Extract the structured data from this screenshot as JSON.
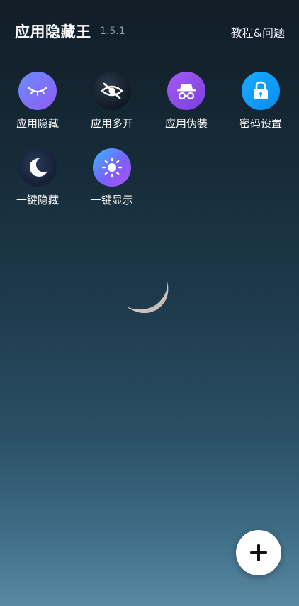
{
  "header": {
    "title": "应用隐藏王",
    "version": "1.5.1",
    "help_link": "教程&问题"
  },
  "grid": {
    "items": [
      {
        "label": "应用隐藏",
        "icon": "eye-closed-icon",
        "color": "#7b74f5"
      },
      {
        "label": "应用多开",
        "icon": "eye-off-icon",
        "color": "#1a2533"
      },
      {
        "label": "应用伪装",
        "icon": "incognito-icon",
        "color": "#9150ea"
      },
      {
        "label": "密码设置",
        "icon": "lock-icon",
        "color": "#12a0fa"
      },
      {
        "label": "一键隐藏",
        "icon": "moon-star-icon",
        "color": "#1a2640"
      },
      {
        "label": "一键显示",
        "icon": "sun-icon",
        "color": "#6f7dfb"
      }
    ]
  },
  "fab": {
    "icon": "plus-icon"
  },
  "background": {
    "decoration": "crescent-moon"
  }
}
